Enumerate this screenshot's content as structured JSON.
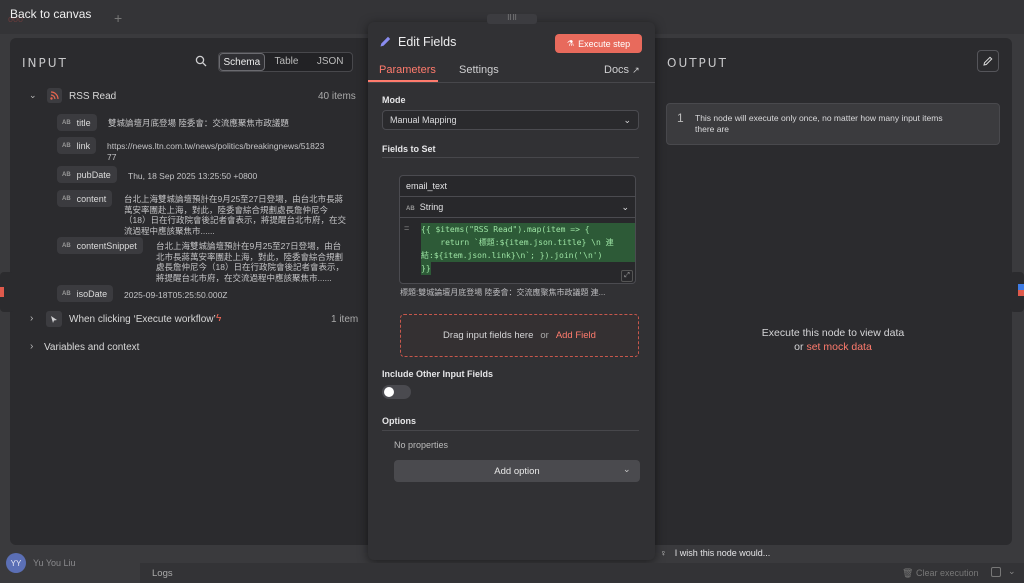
{
  "canvas": {
    "back_label": "Back to canvas",
    "user_name": "Yu You Liu",
    "user_initials": "YY",
    "logs_label": "Logs",
    "clear_execution": "Clear execution",
    "feedback_text": "I wish this node would..."
  },
  "input": {
    "title": "INPUT",
    "view_tabs": [
      "Schema",
      "Table",
      "JSON"
    ],
    "active_view": "Schema",
    "rss_node": {
      "name": "RSS Read",
      "count": "40 items"
    },
    "fields": [
      {
        "name": "title",
        "value": "雙城論壇月底登場 陸委會：交流應聚焦市政議題"
      },
      {
        "name": "link",
        "value_lines": [
          "https://news.ltn.com.tw/news/politics/breakingnews/51823",
          "77"
        ]
      },
      {
        "name": "pubDate",
        "value": "Thu, 18 Sep 2025 13:25:50 +0800"
      },
      {
        "name": "content",
        "value_lines": [
          "台北上海雙城論壇預計在9月25至27日登場，由台北市長蔣",
          "萬安率團赴上海，對此，陸委會綜合規劃處長詹仲尼今",
          "（18）日在行政院會後記者會表示，將提醒台北市府，在交",
          "流過程中應該聚焦市......"
        ]
      },
      {
        "name": "contentSnippet",
        "value_lines": [
          "台北上海雙城論壇預計在9月25至27日登場，由台",
          "北市長蔣萬安率團赴上海，對此，陸委會綜合規劃",
          "處長詹仲尼今（18）日在行政院會後記者會表示，",
          "將提醒台北市府，在交流過程中應該聚焦市......"
        ]
      },
      {
        "name": "isoDate",
        "value": "2025-09-18T05:25:50.000Z"
      }
    ],
    "trigger_node": {
      "name": "When clicking ‘Execute workflow’",
      "count": "1 item"
    },
    "variables_label": "Variables and context"
  },
  "editor": {
    "title": "Edit Fields",
    "execute_label": "Execute step",
    "tabs": {
      "parameters": "Parameters",
      "settings": "Settings",
      "docs": "Docs"
    },
    "mode_label": "Mode",
    "mode_value": "Manual Mapping",
    "fields_label": "Fields to Set",
    "field_name": "email_text",
    "field_type": "String",
    "expression_lines": [
      "{{ $items(\"RSS Read\").map(item => {",
      "    return `標題:${item.json.title} \\n 連",
      "結:${item.json.link}\\n`; }).join('\\n')",
      "}}"
    ],
    "preview": "標題:雙城論壇月底登場 陸委會：交流應聚焦市政議題  連...",
    "drop_text": "Drag input fields here",
    "drop_or": "or",
    "add_field": "Add Field",
    "include_label": "Include Other Input Fields",
    "options_label": "Options",
    "no_properties": "No properties",
    "add_option": "Add option"
  },
  "output": {
    "title": "OUTPUT",
    "info_number": "1",
    "info_line1": "This node will execute only once, no matter how many input items",
    "info_line2": "there are",
    "execute_hint": "Execute this node to view data",
    "or_text": "or",
    "mock_link": "set mock data"
  },
  "colors": {
    "accent": "#ff6d5a",
    "panel": "#2b2b2e",
    "green_code": "#2d5a37"
  }
}
